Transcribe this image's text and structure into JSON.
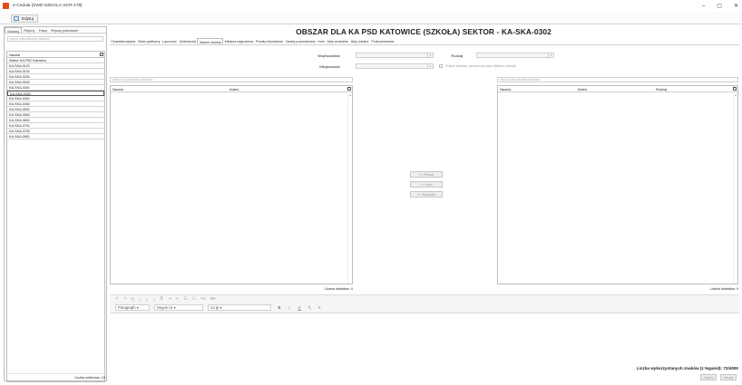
{
  "window": {
    "title": "e-Cedula [SWD-SZKOLA-SCR-178]",
    "controls": [
      "–",
      "▢",
      "✕"
    ]
  },
  "ribbon": {
    "button_label": "Edytuj"
  },
  "left_panel": {
    "tabs": [
      "Sektory",
      "Rejony",
      "Trasy",
      "Rejony patrolowe"
    ],
    "search_placeholder": "<wpisz wyszukiwany wartość>",
    "column_header": "Nazwa",
    "rows": [
      "Sektor KA PSD Katowice",
      "KA-SKA-0101",
      "KA-SKA-0102",
      "KA-SKA-0201",
      "KA-SKA-0202",
      "KA-SKA-0301",
      "KA-SKA-0302",
      "KA-SKA-0401",
      "KA-SKA-0402",
      "KA-SKA-0501",
      "KA-SKA-0502",
      "KA-SKA-0601",
      "KA-SKA-0701",
      "KA-SKA-0702",
      "KA-SKA-0901"
    ],
    "selected_row": "KA-SKA-0302",
    "footer": "Liczba sektorów: 15"
  },
  "main": {
    "title": "OBSZAR DLA KA PSD KATOWICE (SZKOŁA) SEKTOR - KA-SKA-0302",
    "tabs": [
      "Charakterystyka",
      "Szkic graficzny",
      "Łączność",
      "Dzielnicowi",
      "Ważne obiekty",
      "Miejsca zagrożenia",
      "Punkty blokadowe",
      "Osoby poszukiwane",
      "Inne",
      "Akty centralne",
      "Akty lokalne",
      "Podsumowanie"
    ],
    "active_tab": "Ważne obiekty",
    "filters": {
      "wojewodztwo_label": "Województwo",
      "miejscowosc_label": "Miejscowość",
      "rodzaj_label": "Rodzaj",
      "checkbox_label": "Pokaż obiekty, oznaczone jako Ważne obiekty"
    },
    "left_grid": {
      "search_placeholder": "<wpisz wyszukiwaną wartość>",
      "headers": [
        "Nazwa",
        "Adres"
      ],
      "count": "Liczba obiektów: 0"
    },
    "right_grid": {
      "search_placeholder": "<wpisz wyszukiwaną wartość>",
      "headers": [
        "Nazwa",
        "Adres",
        "Rodzaj"
      ],
      "count": "Liczba obiektów: 0"
    },
    "move_buttons": [
      "<< Powiąż",
      "<< Usuń",
      "<< Wszystko"
    ]
  },
  "editor": {
    "toolbar_icons": [
      "undo-icon",
      "redo-icon",
      "paste-icon",
      "align-left-icon",
      "align-center-icon",
      "align-right-icon",
      "justify-icon",
      "indent-icon",
      "outdent-icon",
      "bullets-icon",
      "numbering-icon",
      "highlight-icon",
      "table-icon"
    ],
    "paragraph_style": "Paragraph",
    "font_name": "Segoe UI",
    "font_size": "12 pt",
    "format_buttons": [
      "B",
      "I",
      "U",
      "T̶",
      "A"
    ],
    "char_count": "Liczba wykorzystanych znaków (z tegamiI): 72/4000"
  },
  "footer_buttons": [
    "Zapisz",
    "Anuluj"
  ]
}
